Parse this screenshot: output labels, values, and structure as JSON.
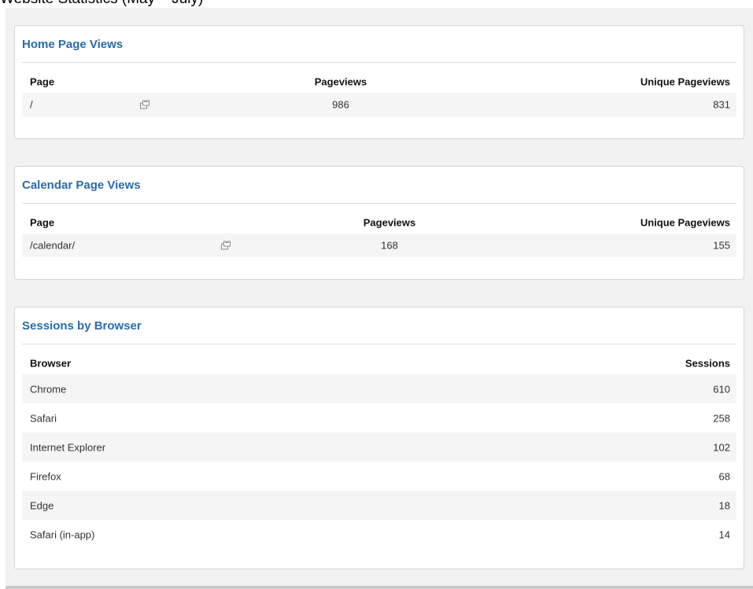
{
  "page": {
    "heading": "Website Statistics (May – July)"
  },
  "colors": {
    "panel_title": "#2a6ba8",
    "background": "#f2f2f2",
    "zebra_row": "#f5f5f5"
  },
  "home_page_views": {
    "title": "Home Page Views",
    "columns": [
      "Page",
      "Pageviews",
      "Unique Pageviews"
    ],
    "rows": [
      {
        "page": "/",
        "pageviews": "986",
        "unique_pageviews": "831",
        "icon": "open-external-icon"
      }
    ]
  },
  "calendar_page_views": {
    "title": "Calendar Page Views",
    "columns": [
      "Page",
      "Pageviews",
      "Unique Pageviews"
    ],
    "rows": [
      {
        "page": "/calendar/",
        "pageviews": "168",
        "unique_pageviews": "155",
        "icon": "open-external-icon"
      }
    ]
  },
  "sessions_by_browser": {
    "title": "Sessions by Browser",
    "columns": [
      "Browser",
      "Sessions"
    ],
    "rows": [
      {
        "browser": "Chrome",
        "sessions": "610"
      },
      {
        "browser": "Safari",
        "sessions": "258"
      },
      {
        "browser": "Internet Explorer",
        "sessions": "102"
      },
      {
        "browser": "Firefox",
        "sessions": "68"
      },
      {
        "browser": "Edge",
        "sessions": "18"
      },
      {
        "browser": "Safari (in-app)",
        "sessions": "14"
      }
    ]
  }
}
